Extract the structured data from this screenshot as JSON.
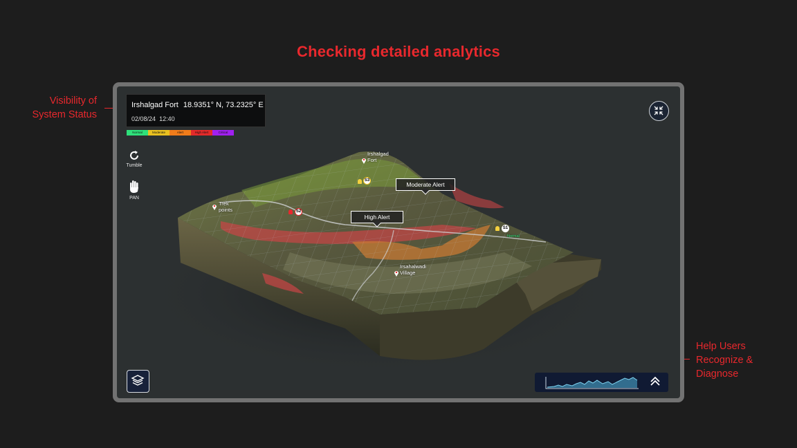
{
  "headline": "Checking detailed analytics",
  "annotations": {
    "left_line1": "Visibility of",
    "left_line2": "System Status",
    "right_line1": "Help Users",
    "right_line2": "Recognize &",
    "right_line3": "Diagnose"
  },
  "status": {
    "location": "Irshalgad Fort",
    "coordinates": "18.9351° N, 73.2325° E",
    "date": "02/08/24",
    "time": "12:40"
  },
  "legend": [
    {
      "label": "Normal",
      "color": "#2ee07a"
    },
    {
      "label": "Moderate",
      "color": "#e8c020"
    },
    {
      "label": "Alert",
      "color": "#f07c1a"
    },
    {
      "label": "High Alert",
      "color": "#e32a2a"
    },
    {
      "label": "Critical",
      "color": "#a020f0"
    }
  ],
  "tools": {
    "tumble_label": "Tumble",
    "pan_label": "PAN"
  },
  "map": {
    "fort_line1": "Irshalgad",
    "fort_line2": "Fort",
    "trek_line1": "Trek",
    "trek_line2": "points",
    "village_line1": "Irsahalwadi",
    "village_line2": "Village",
    "moderate_alert": "Moderate  Alert",
    "high_alert": "High Alert",
    "sensors": [
      "S1",
      "S2",
      "S3"
    ],
    "sensor_s1_status": "Normal"
  },
  "icons": {
    "collapse": "collapse-arrows-icon",
    "layers": "layers-icon",
    "tumble": "rotate-icon",
    "pan": "hand-icon",
    "timeline_toggle": "chevron-up-icon"
  },
  "colors": {
    "accent": "#e8282d",
    "panel": "#2c3031",
    "frame": "#727272",
    "button_bg": "#17213a",
    "sparkline": "#4fb3d9"
  }
}
